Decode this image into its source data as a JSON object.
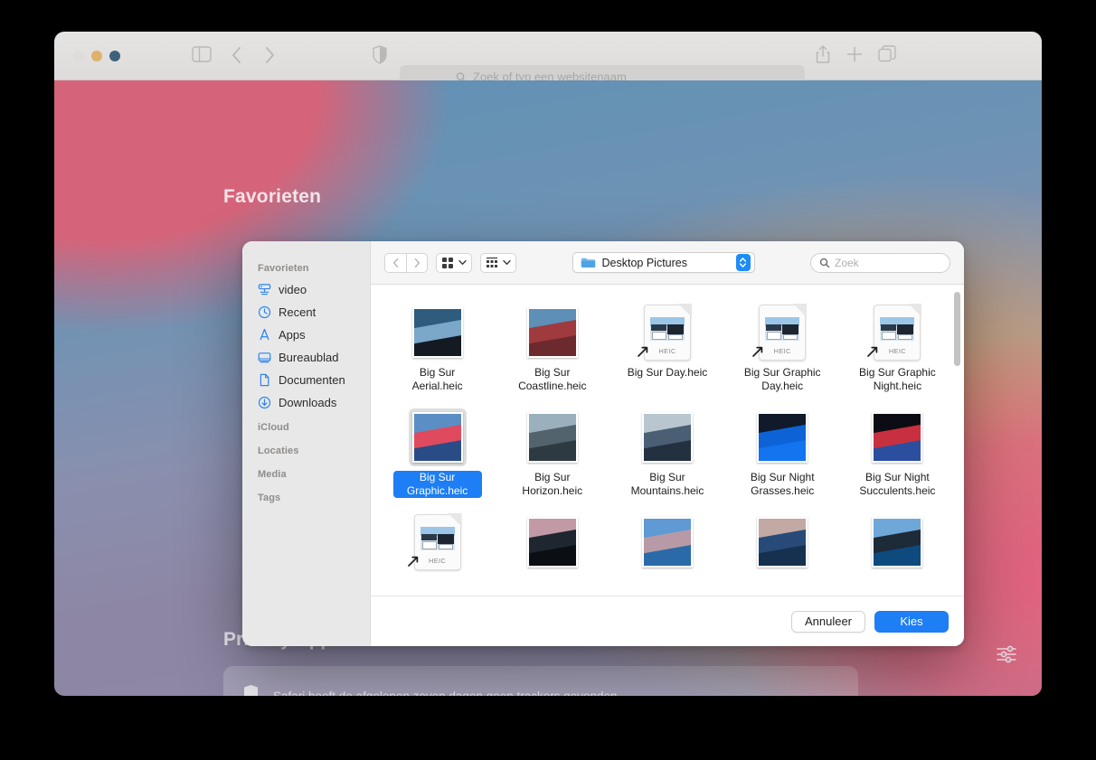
{
  "browser": {
    "window_controls": [
      "close",
      "minimize",
      "zoom"
    ],
    "sidebar_toggle_icon": "sidebar-icon",
    "back_icon": "chevron-left-icon",
    "forward_icon": "chevron-right-icon",
    "shield_icon": "privacy-shield-icon",
    "share_icon": "share-icon",
    "new_tab_icon": "plus-icon",
    "tab_overview_icon": "tab-overview-icon",
    "address_bar": {
      "value": "",
      "placeholder": "Zoek of typ een websitenaam",
      "search_icon": "search-icon"
    }
  },
  "start_page": {
    "favorites_heading": "Favorieten",
    "privacy_heading": "Privacyrapport",
    "privacy_message": "Safari heeft de afgelopen zeven dagen geen trackers gevonden.",
    "privacy_icon": "shield-icon",
    "settings_icon": "sliders-icon"
  },
  "dialog": {
    "sidebar": {
      "groups": [
        {
          "title": "Favorieten",
          "items": [
            {
              "label": "video",
              "icon": "server-icon"
            },
            {
              "label": "Recent",
              "icon": "clock-icon"
            },
            {
              "label": "Apps",
              "icon": "applications-icon"
            },
            {
              "label": "Bureaublad",
              "icon": "desktop-icon"
            },
            {
              "label": "Documenten",
              "icon": "document-icon"
            },
            {
              "label": "Downloads",
              "icon": "download-icon"
            }
          ]
        },
        {
          "title": "iCloud",
          "items": []
        },
        {
          "title": "Locaties",
          "items": []
        },
        {
          "title": "Media",
          "items": []
        },
        {
          "title": "Tags",
          "items": []
        }
      ]
    },
    "toolbar": {
      "back_icon": "chevron-left-icon",
      "forward_icon": "chevron-right-icon",
      "icon_view_icon": "grid-view-icon",
      "icon_view_chevron": "chevron-down-icon",
      "group_view_icon": "list-view-icon",
      "group_view_chevron": "chevron-down-icon",
      "path_label": "Desktop Pictures",
      "path_folder_icon": "folder-icon",
      "path_stepper_icon": "up-down-chevron-icon",
      "search_placeholder": "Zoek",
      "search_value": "",
      "search_icon": "search-icon"
    },
    "files": [
      {
        "label": "Big Sur Aerial.heic",
        "kind": "photo",
        "c1": "#2f5c7e",
        "c2": "#7ba8c9",
        "c3": "#141a22",
        "selected": false
      },
      {
        "label": "Big Sur Coastline.heic",
        "kind": "photo",
        "c1": "#5d8fb7",
        "c2": "#9f3a3f",
        "c3": "#6d2a2e",
        "selected": false
      },
      {
        "label": "Big Sur Day.heic",
        "kind": "document",
        "ext": "HEIC",
        "alias": true,
        "selected": false
      },
      {
        "label": "Big Sur Graphic Day.heic",
        "kind": "document",
        "ext": "HEIC",
        "alias": true,
        "selected": false
      },
      {
        "label": "Big Sur Graphic Night.heic",
        "kind": "document",
        "ext": "HEIC",
        "alias": true,
        "selected": false
      },
      {
        "label": "Big Sur Graphic.heic",
        "kind": "photo",
        "c1": "#5b8ec4",
        "c2": "#e04a5e",
        "c3": "#2a4c86",
        "selected": true
      },
      {
        "label": "Big Sur Horizon.heic",
        "kind": "photo",
        "c1": "#9bb0bd",
        "c2": "#53636e",
        "c3": "#2e3a42",
        "selected": false
      },
      {
        "label": "Big Sur Mountains.heic",
        "kind": "photo",
        "c1": "#b9c6cf",
        "c2": "#4a5f74",
        "c3": "#22303f",
        "selected": false
      },
      {
        "label": "Big Sur Night Grasses.heic",
        "kind": "photo",
        "c1": "#101a2a",
        "c2": "#0d63d6",
        "c3": "#1274ef",
        "selected": false
      },
      {
        "label": "Big Sur Night Succulents.heic",
        "kind": "photo",
        "c1": "#0c0d14",
        "c2": "#c8303f",
        "c3": "#2b4f9e",
        "selected": false
      },
      {
        "label": "",
        "kind": "document",
        "ext": "HEIC",
        "alias": true,
        "selected": false
      },
      {
        "label": "",
        "kind": "photo",
        "c1": "#c29aa6",
        "c2": "#1e2630",
        "c3": "#0b0e13",
        "selected": false
      },
      {
        "label": "",
        "kind": "photo",
        "c1": "#5f9ad4",
        "c2": "#b89aa6",
        "c3": "#2b6aa8",
        "selected": false
      },
      {
        "label": "",
        "kind": "photo",
        "c1": "#c3a9a4",
        "c2": "#274a78",
        "c3": "#16314f",
        "selected": false
      },
      {
        "label": "",
        "kind": "photo",
        "c1": "#6fa8d8",
        "c2": "#1d2a38",
        "c3": "#0f4a7e",
        "selected": false
      }
    ],
    "footer": {
      "cancel_label": "Annuleer",
      "choose_label": "Kies"
    }
  },
  "colors": {
    "accent_blue": "#1d7ef5",
    "selection_blue": "#1d7ef5",
    "sidebar_gray": "#e9e8e8"
  }
}
